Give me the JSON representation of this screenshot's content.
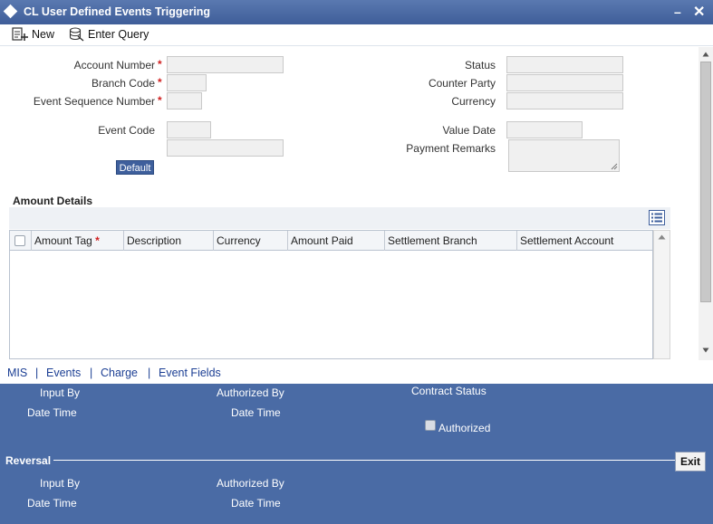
{
  "window": {
    "title": "CL User Defined Events Triggering",
    "minimize": "–",
    "close": "✕"
  },
  "toolbar": {
    "new_label": "New",
    "enter_query_label": "Enter Query"
  },
  "form": {
    "required_mark": "*",
    "account_number": {
      "label": "Account Number",
      "value": ""
    },
    "branch_code": {
      "label": "Branch Code",
      "value": ""
    },
    "event_sequence_number": {
      "label": "Event Sequence Number",
      "value": ""
    },
    "event_code": {
      "label": "Event Code",
      "value": "",
      "description": ""
    },
    "default_button": "Default",
    "status": {
      "label": "Status",
      "value": ""
    },
    "counter_party": {
      "label": "Counter Party",
      "value": ""
    },
    "currency": {
      "label": "Currency",
      "value": ""
    },
    "value_date": {
      "label": "Value Date",
      "value": ""
    },
    "payment_remarks": {
      "label": "Payment Remarks",
      "value": ""
    }
  },
  "amount_details": {
    "title": "Amount Details",
    "columns": [
      "Amount Tag",
      "Description",
      "Currency",
      "Amount Paid",
      "Settlement Branch",
      "Settlement Account"
    ],
    "rows": []
  },
  "tabs": [
    "MIS",
    "Events",
    "Charge",
    "Event Fields"
  ],
  "tab_separator": "|",
  "footer": {
    "input_by": "Input By",
    "date_time": "Date Time",
    "authorized_by": "Authorized By",
    "contract_status": "Contract Status",
    "authorized": "Authorized",
    "reversal": "Reversal",
    "exit": "Exit"
  },
  "colors": {
    "title_bar": "#3f5e99",
    "footer": "#4a6ba5",
    "tab_link": "#1c3f94",
    "required": "#d02020"
  }
}
